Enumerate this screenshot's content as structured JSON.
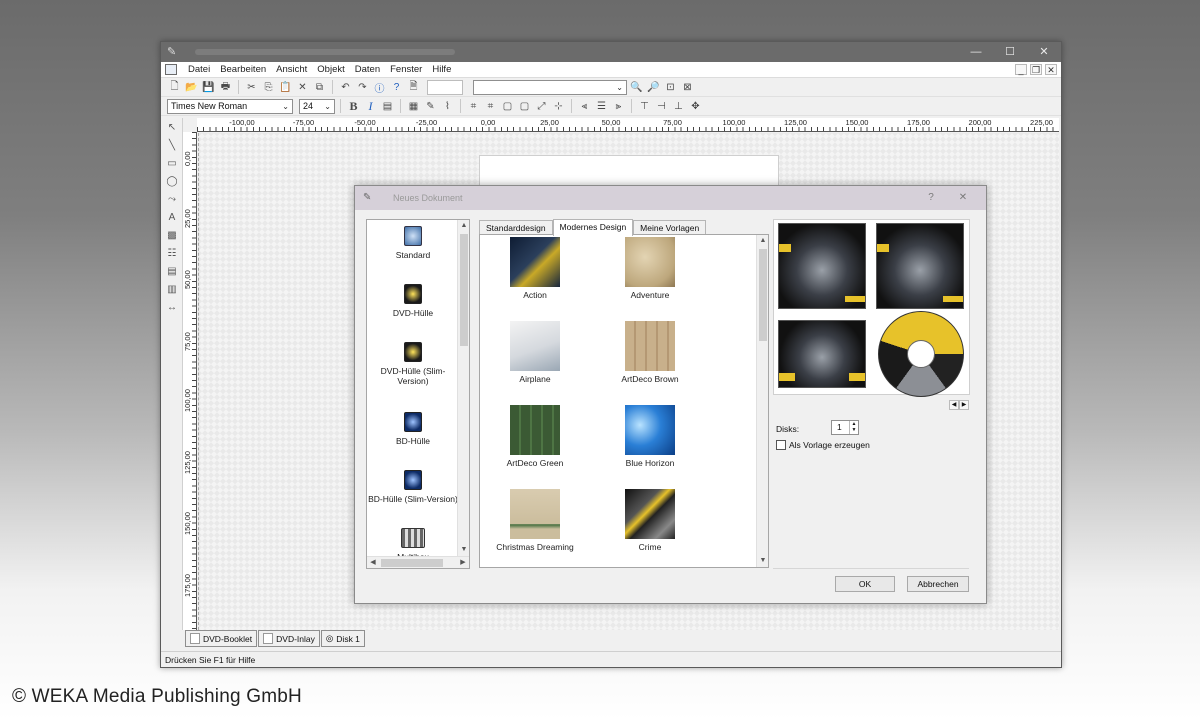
{
  "app": {
    "menu": [
      "Datei",
      "Bearbeiten",
      "Ansicht",
      "Objekt",
      "Daten",
      "Fenster",
      "Hilfe"
    ],
    "font_name": "Times New Roman",
    "font_size": "24",
    "status": "Drücken Sie F1 für Hilfe",
    "doc_tabs": [
      "DVD-Booklet",
      "DVD-Inlay",
      "Disk 1"
    ]
  },
  "ruler_h": [
    "-100,00",
    "-75,00",
    "-50,00",
    "-25,00",
    "0,00",
    "25,00",
    "50,00",
    "75,00",
    "100,00",
    "125,00",
    "150,00",
    "175,00",
    "200,00",
    "225,00"
  ],
  "ruler_v": [
    "0,00",
    "25,00",
    "50,00",
    "75,00",
    "100,00",
    "125,00",
    "150,00",
    "175,00"
  ],
  "dialog": {
    "title": "Neues Dokument",
    "categories": [
      "Standard",
      "DVD-Hülle",
      "DVD-Hülle (Slim-Version)",
      "BD-Hülle",
      "BD-Hülle (Slim-Version)",
      "Multibox"
    ],
    "tabs": [
      "Standarddesign",
      "Modernes Design",
      "Meine Vorlagen"
    ],
    "designs": [
      "Action",
      "Adventure",
      "Airplane",
      "ArtDeco Brown",
      "ArtDeco Green",
      "Blue Horizon",
      "Christmas Dreaming",
      "Crime"
    ],
    "disks_label": "Disks:",
    "disks_value": "1",
    "template_checkbox": "Als Vorlage erzeugen",
    "ok": "OK",
    "cancel": "Abbrechen"
  },
  "copyright": "© WEKA Media Publishing GmbH",
  "colors": {
    "accent_yellow": "#e7c22a",
    "dialog_title": "#d6d0d9"
  }
}
